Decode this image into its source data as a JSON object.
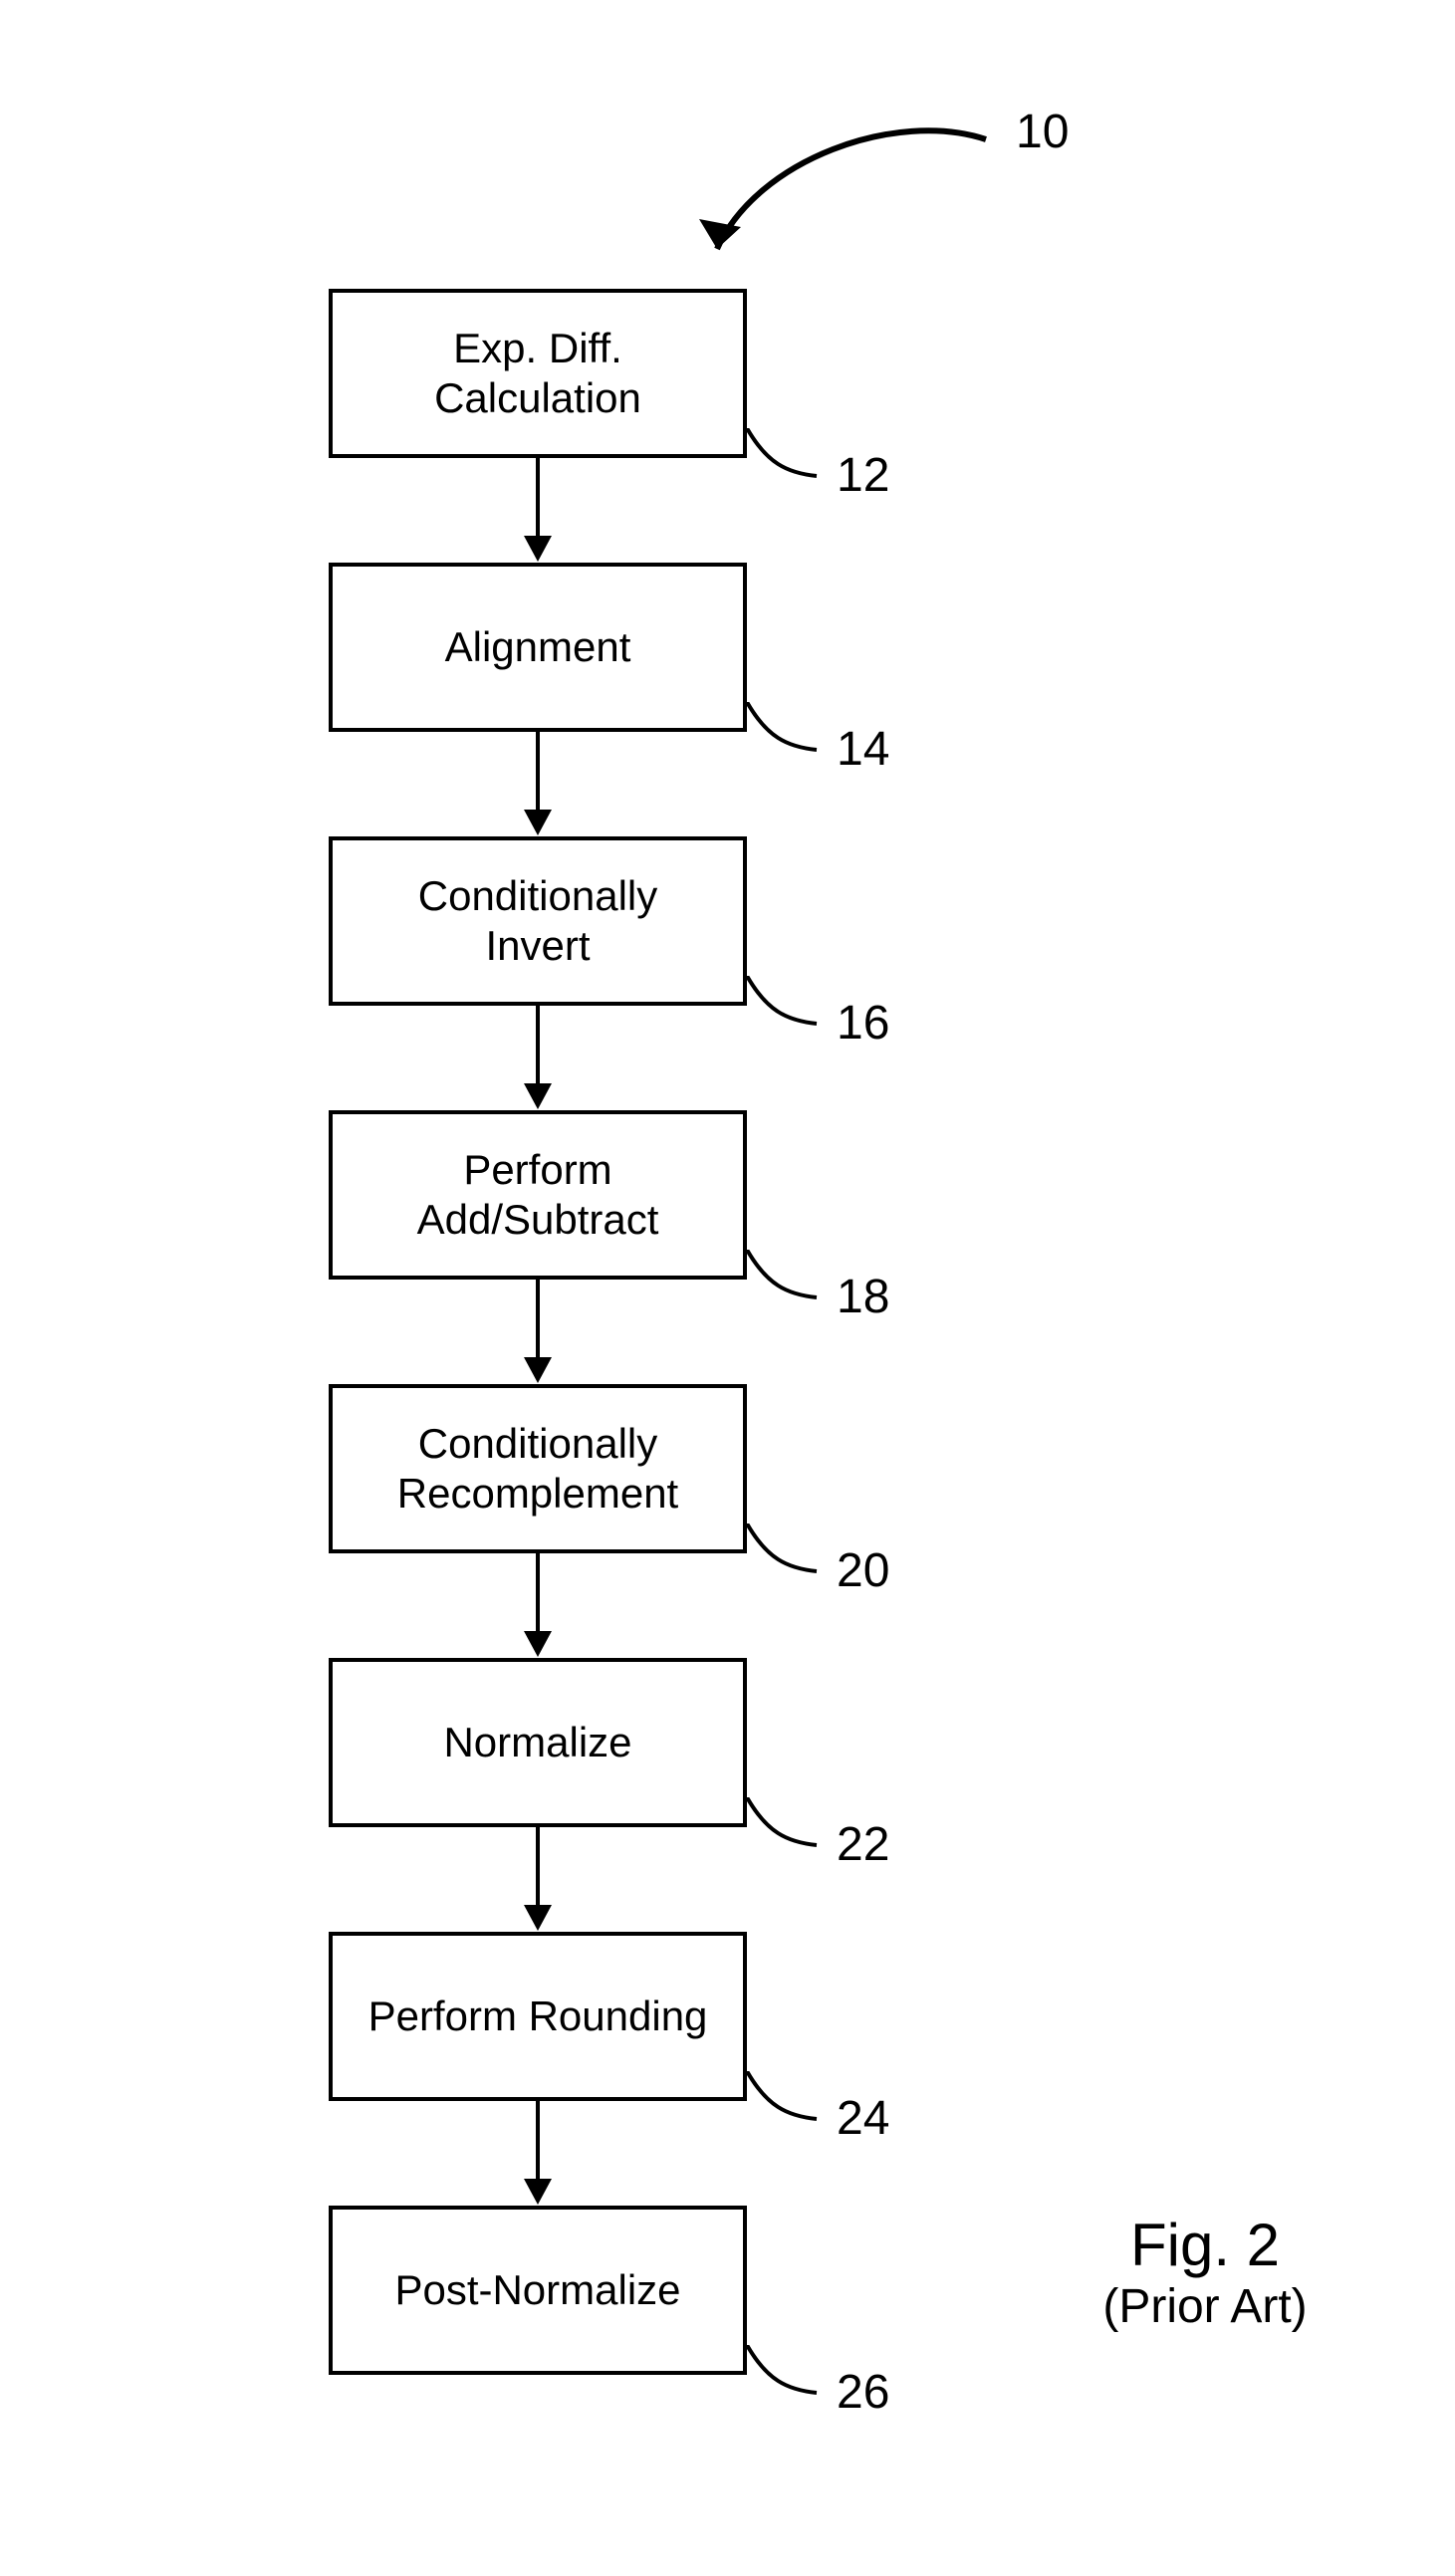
{
  "pointer_label": "10",
  "boxes": [
    {
      "text": "Exp. Diff.\nCalculation",
      "label": "12"
    },
    {
      "text": "Alignment",
      "label": "14"
    },
    {
      "text": "Conditionally\nInvert",
      "label": "16"
    },
    {
      "text": "Perform\nAdd/Subtract",
      "label": "18"
    },
    {
      "text": "Conditionally\nRecomplement",
      "label": "20"
    },
    {
      "text": "Normalize",
      "label": "22"
    },
    {
      "text": "Perform Rounding",
      "label": "24"
    },
    {
      "text": "Post-Normalize",
      "label": "26"
    }
  ],
  "caption": {
    "title": "Fig. 2",
    "subtitle": "(Prior Art)"
  }
}
